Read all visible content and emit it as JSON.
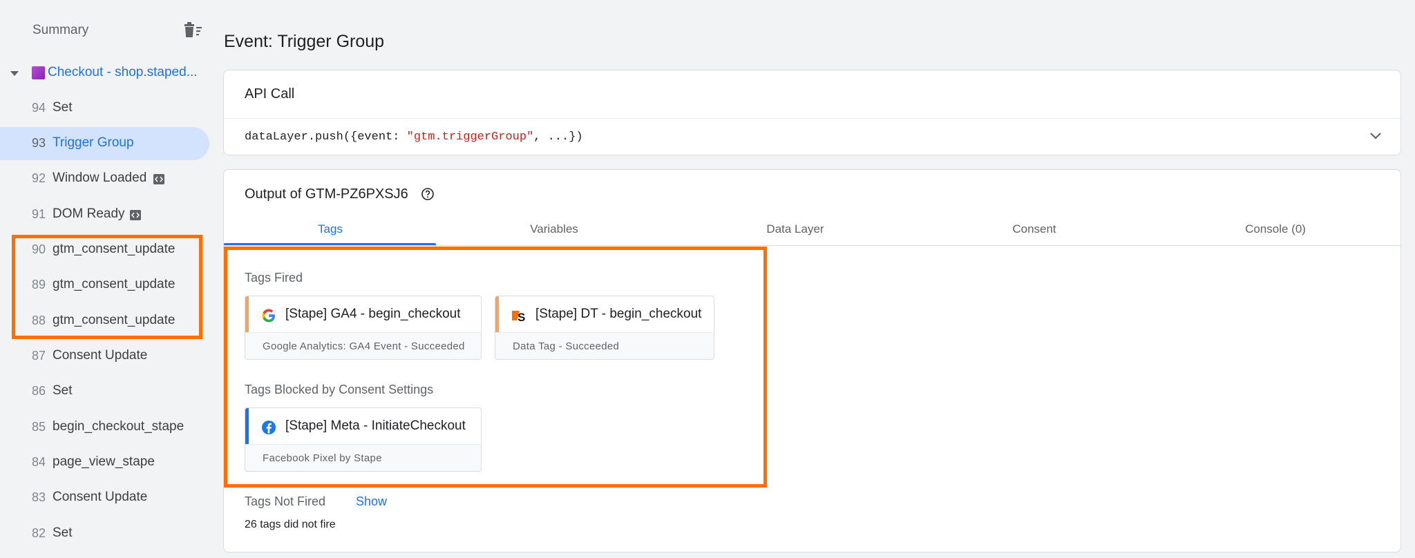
{
  "sidebar": {
    "summary_label": "Summary",
    "container_name": "Checkout - shop.staped...",
    "events": [
      {
        "num": "94",
        "name": "Set"
      },
      {
        "num": "93",
        "name": "Trigger Group"
      },
      {
        "num": "92",
        "name": "Window Loaded"
      },
      {
        "num": "91",
        "name": "DOM Ready"
      },
      {
        "num": "90",
        "name": "gtm_consent_update"
      },
      {
        "num": "89",
        "name": "gtm_consent_update"
      },
      {
        "num": "88",
        "name": "gtm_consent_update"
      },
      {
        "num": "87",
        "name": "Consent Update"
      },
      {
        "num": "86",
        "name": "Set"
      },
      {
        "num": "85",
        "name": "begin_checkout_stape"
      },
      {
        "num": "84",
        "name": "page_view_stape"
      },
      {
        "num": "83",
        "name": "Consent Update"
      },
      {
        "num": "82",
        "name": "Set"
      }
    ]
  },
  "main": {
    "page_title": "Event: Trigger Group",
    "api_call": {
      "title": "API Call",
      "code_prefix": "dataLayer.push({event: ",
      "code_string": "\"gtm.triggerGroup\"",
      "code_suffix": ", ...})"
    },
    "output": {
      "title": "Output of GTM-PZ6PXSJ6",
      "tabs": [
        "Tags",
        "Variables",
        "Data Layer",
        "Consent",
        "Console (0)"
      ],
      "tags_fired_label": "Tags Fired",
      "tags_fired": [
        {
          "name": "[Stape] GA4 - begin_checkout",
          "type": "Google Analytics: GA4 Event - Succeeded"
        },
        {
          "name": "[Stape] DT - begin_checkout",
          "type": "Data Tag - Succeeded"
        }
      ],
      "tags_blocked_label": "Tags Blocked by Consent Settings",
      "tags_blocked": [
        {
          "name": "[Stape] Meta - InitiateCheckout",
          "type": "Facebook Pixel by Stape"
        }
      ],
      "tags_not_fired_label": "Tags Not Fired",
      "show_label": "Show",
      "not_fired_count": "26 tags did not fire"
    }
  },
  "colors": {
    "accent": "#1a73e8",
    "highlight": "#ff6f00",
    "fired_stripe": "#f4a460",
    "blocked_stripe": "#1a73e8",
    "active_item_bg": "#d3e3fd"
  }
}
